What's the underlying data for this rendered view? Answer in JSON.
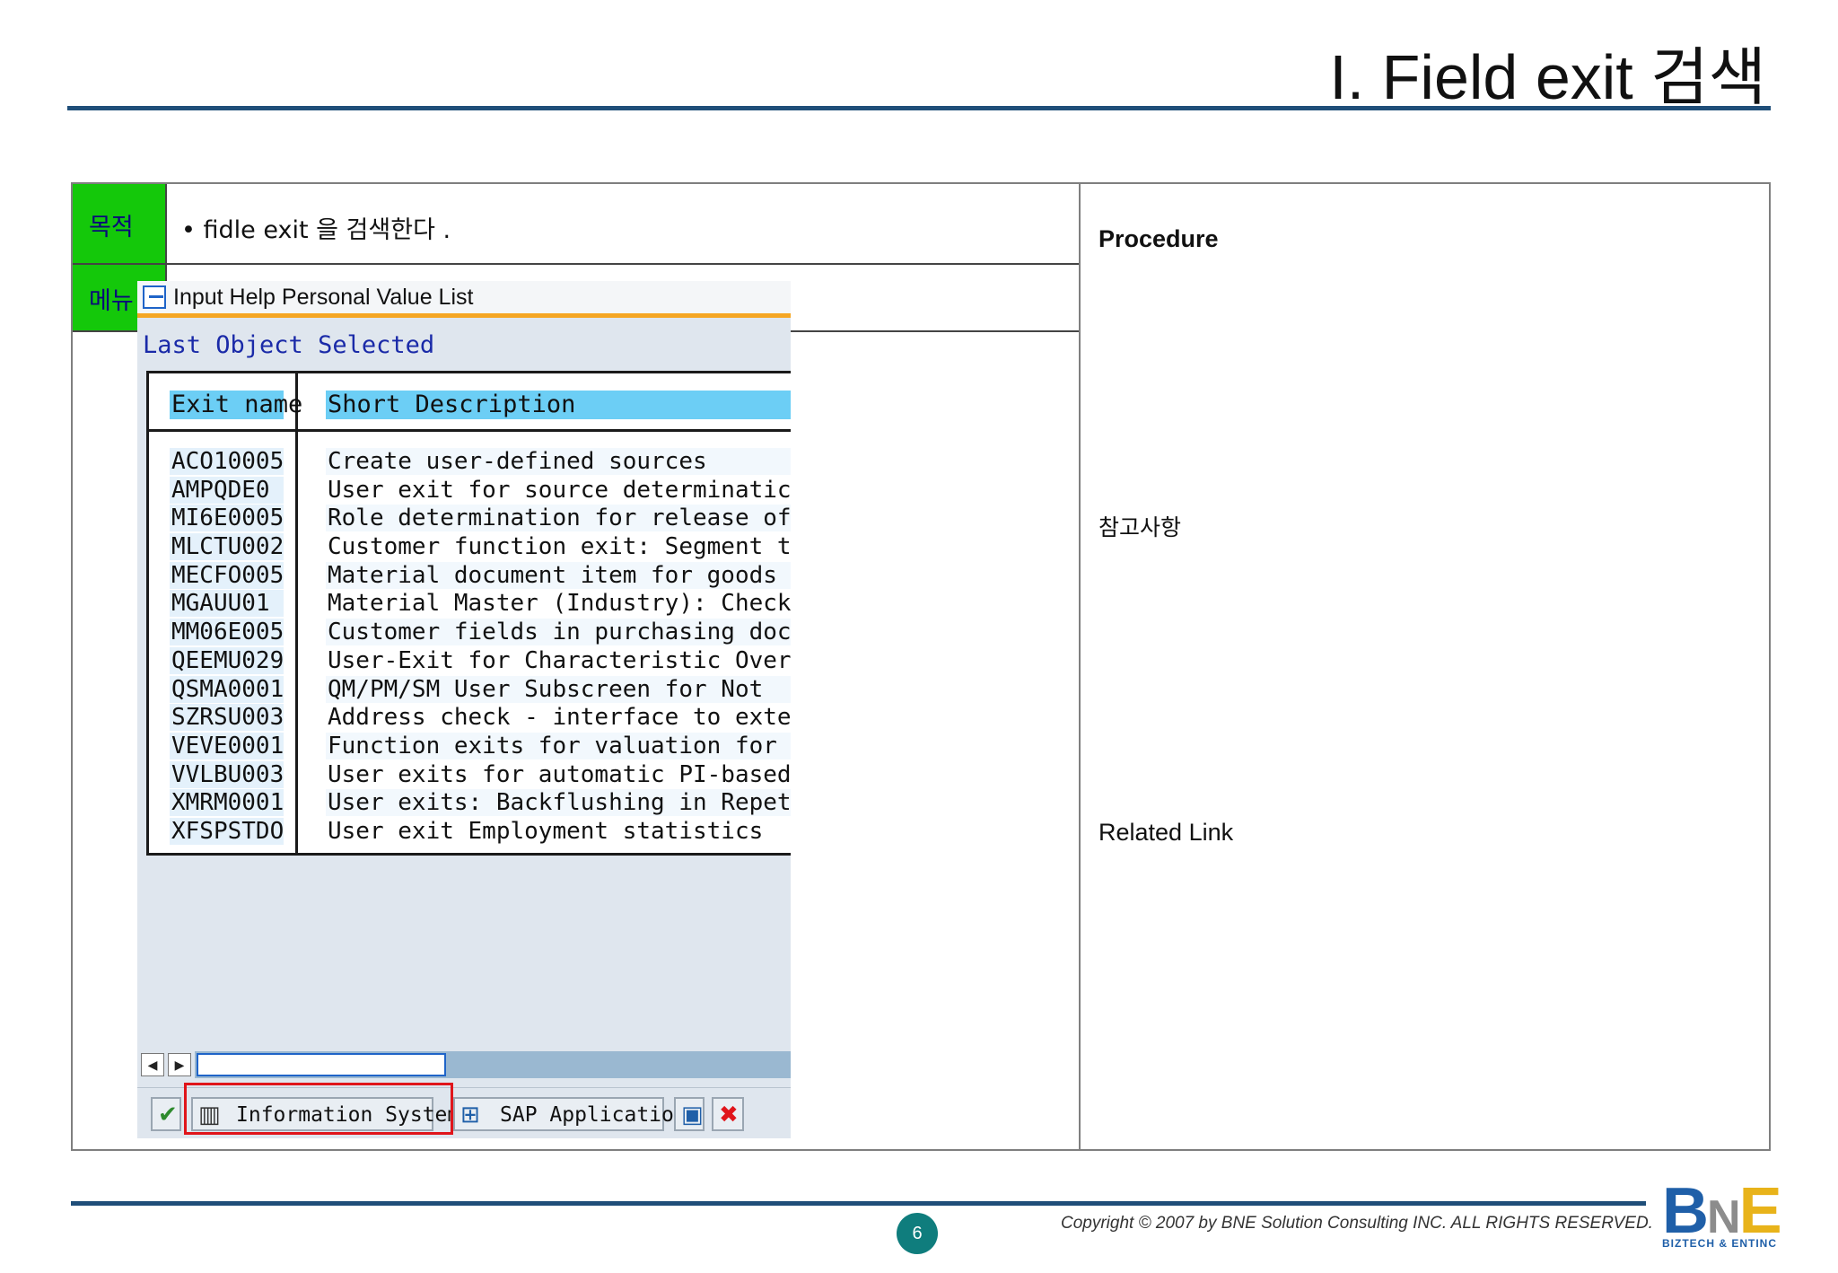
{
  "slide": {
    "title": "I. Field exit 검색",
    "purpose_label": "목적",
    "purpose_text": "• fidle exit 을 검색한다 .",
    "menu_label": "메뉴",
    "procedure_label": "Procedure",
    "reference_label": "참고사항",
    "related_label": "Related Link"
  },
  "dialog": {
    "title": "Input Help Personal Value List",
    "caption": "Last Object Selected",
    "columns": [
      "Exit name",
      "Short Description"
    ],
    "rows": [
      {
        "name": "ACO10005",
        "desc": "Create user-defined sources"
      },
      {
        "name": "AMPQDE0",
        "desc": "User exit for source determinatic"
      },
      {
        "name": "MI6E0005",
        "desc": "Role determination for release of"
      },
      {
        "name": "MLCTU002",
        "desc": "Customer function exit: Segment t"
      },
      {
        "name": "MECFO005",
        "desc": "Material document item for goods"
      },
      {
        "name": "MGAUU01",
        "desc": "Material Master (Industry): Check"
      },
      {
        "name": "MM06E005",
        "desc": "Customer fields in purchasing doc"
      },
      {
        "name": "QEEMU029",
        "desc": "User-Exit for Characteristic Over"
      },
      {
        "name": "QSMA0001",
        "desc": "QM/PM/SM User Subscreen for Not"
      },
      {
        "name": "SZRSU003",
        "desc": "Address check - interface to exte"
      },
      {
        "name": "VEVE0001",
        "desc": "Function exits for valuation for"
      },
      {
        "name": "VVLBU003",
        "desc": "User exits for automatic PI-based"
      },
      {
        "name": "XMRM0001",
        "desc": "User exits: Backflushing in Repet"
      },
      {
        "name": "XFSPSTDO",
        "desc": "User exit Employment statistics"
      }
    ],
    "buttons": {
      "ok_icon": "checkmark-icon",
      "info_label": "Information System",
      "sap_label": "SAP Applications",
      "save_icon": "save-icon",
      "cancel_icon": "cancel-icon"
    }
  },
  "footer": {
    "page_number": "6",
    "copyright": "Copyright © 2007 by BNE Solution Consulting INC.   ALL RIGHTS RESERVED.",
    "logo_text": "BNE",
    "logo_subtext": "BIZTECH & ENTINC"
  }
}
